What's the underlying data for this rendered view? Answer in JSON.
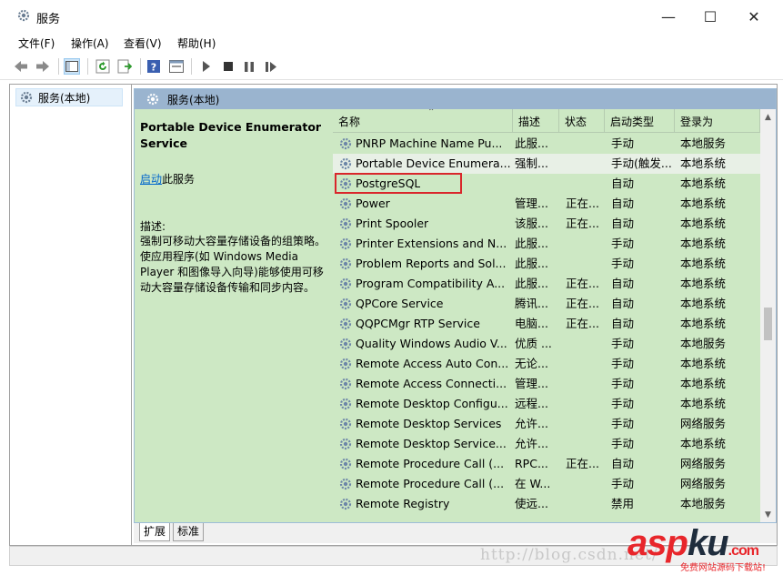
{
  "window": {
    "title": "服务",
    "minimize_glyph": "—",
    "maximize_glyph": "☐",
    "close_glyph": "✕"
  },
  "menu": [
    {
      "label": "文件(F)"
    },
    {
      "label": "操作(A)"
    },
    {
      "label": "查看(V)"
    },
    {
      "label": "帮助(H)"
    }
  ],
  "toolbar_icons": [
    "back-arrow-icon",
    "forward-arrow-icon",
    "show-hide-tree-icon",
    "refresh-icon",
    "export-list-icon",
    "help-icon",
    "properties-icon",
    "play-icon",
    "stop-icon",
    "pause-icon",
    "restart-icon"
  ],
  "tree": {
    "item_label": "服务(本地)"
  },
  "pane": {
    "header": "服务(本地)",
    "selected_title": "Portable Device Enumerator Service",
    "start_link": "启动",
    "start_suffix": "此服务",
    "desc_label": "描述:",
    "desc_text": "强制可移动大容量存储设备的组策略。使应用程序(如 Windows Media Player 和图像导入向导)能够使用可移动大容量存储设备传输和同步内容。"
  },
  "columns": {
    "name": "名称",
    "desc": "描述",
    "status": "状态",
    "startup": "启动类型",
    "logon": "登录为"
  },
  "rows": [
    {
      "name": "PNRP Machine Name Pu...",
      "desc": "此服...",
      "status": "",
      "startup": "手动",
      "logon": "本地服务"
    },
    {
      "name": "Portable Device Enumera...",
      "desc": "强制...",
      "status": "",
      "startup": "手动(触发...",
      "logon": "本地系统"
    },
    {
      "name": "PostgreSQL",
      "desc": "",
      "status": "",
      "startup": "自动",
      "logon": "本地系统"
    },
    {
      "name": "Power",
      "desc": "管理...",
      "status": "正在...",
      "startup": "自动",
      "logon": "本地系统"
    },
    {
      "name": "Print Spooler",
      "desc": "该服...",
      "status": "正在...",
      "startup": "自动",
      "logon": "本地系统"
    },
    {
      "name": "Printer Extensions and N...",
      "desc": "此服...",
      "status": "",
      "startup": "手动",
      "logon": "本地系统"
    },
    {
      "name": "Problem Reports and Sol...",
      "desc": "此服...",
      "status": "",
      "startup": "手动",
      "logon": "本地系统"
    },
    {
      "name": "Program Compatibility A...",
      "desc": "此服...",
      "status": "正在...",
      "startup": "自动",
      "logon": "本地系统"
    },
    {
      "name": "QPCore Service",
      "desc": "腾讯...",
      "status": "正在...",
      "startup": "自动",
      "logon": "本地系统"
    },
    {
      "name": "QQPCMgr RTP Service",
      "desc": "电脑...",
      "status": "正在...",
      "startup": "自动",
      "logon": "本地系统"
    },
    {
      "name": "Quality Windows Audio V...",
      "desc": "优质 ...",
      "status": "",
      "startup": "手动",
      "logon": "本地服务"
    },
    {
      "name": "Remote Access Auto Con...",
      "desc": "无论...",
      "status": "",
      "startup": "手动",
      "logon": "本地系统"
    },
    {
      "name": "Remote Access Connecti...",
      "desc": "管理...",
      "status": "",
      "startup": "手动",
      "logon": "本地系统"
    },
    {
      "name": "Remote Desktop Configu...",
      "desc": "远程...",
      "status": "",
      "startup": "手动",
      "logon": "本地系统"
    },
    {
      "name": "Remote Desktop Services",
      "desc": "允许...",
      "status": "",
      "startup": "手动",
      "logon": "网络服务"
    },
    {
      "name": "Remote Desktop Service...",
      "desc": "允许...",
      "status": "",
      "startup": "手动",
      "logon": "本地系统"
    },
    {
      "name": "Remote Procedure Call (...",
      "desc": "RPC...",
      "status": "正在...",
      "startup": "自动",
      "logon": "网络服务"
    },
    {
      "name": "Remote Procedure Call (...",
      "desc": "在 W...",
      "status": "",
      "startup": "手动",
      "logon": "网络服务"
    },
    {
      "name": "Remote Registry",
      "desc": "使远...",
      "status": "",
      "startup": "禁用",
      "logon": "本地服务"
    }
  ],
  "selected_row_index": 1,
  "highlighted_row_index": 2,
  "tabs": [
    {
      "label": "扩展"
    },
    {
      "label": "标准"
    }
  ],
  "watermark": {
    "url": "http://blog.csdn.net/",
    "logo_a": "asp",
    "logo_b": "ku",
    "logo_suffix": ".com",
    "tagline": "免费网站源码下载站!"
  },
  "colors": {
    "pane_bg": "#cde8c4",
    "header_bg": "#9ab4cf",
    "highlight": "#d9262b"
  }
}
